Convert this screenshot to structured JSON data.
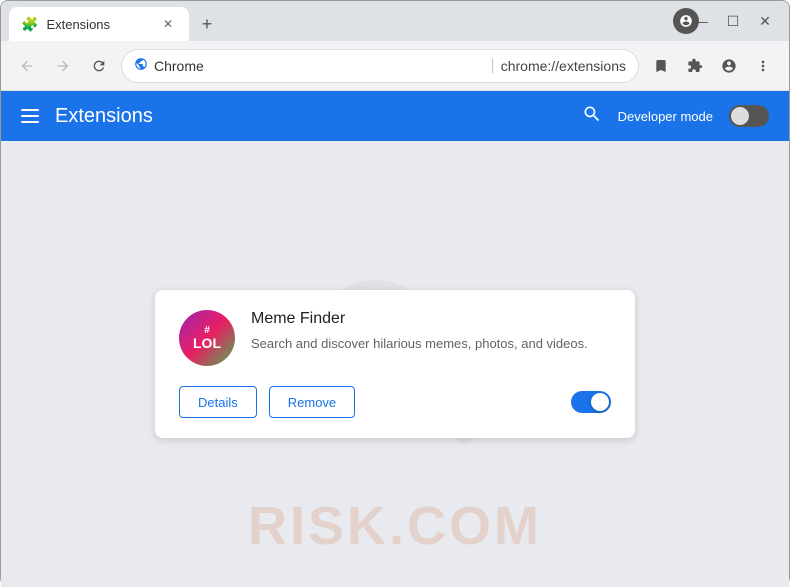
{
  "window": {
    "title": "Extensions",
    "tab_title": "Extensions",
    "tab_icon": "🧩"
  },
  "controls": {
    "minimize": "—",
    "maximize": "☐",
    "close": "✕"
  },
  "address_bar": {
    "site_name": "Chrome",
    "url": "chrome://extensions",
    "back_disabled": true,
    "forward_disabled": true
  },
  "header": {
    "title": "Extensions",
    "search_icon": "search",
    "dev_mode_label": "Developer mode",
    "dev_mode_enabled": false
  },
  "extension": {
    "name": "Meme Finder",
    "description": "Search and discover hilarious memes, photos, and videos.",
    "logo_line1": "#",
    "logo_line2": "LOL",
    "enabled": true,
    "details_label": "Details",
    "remove_label": "Remove"
  },
  "watermark": {
    "text": "RISK.COM"
  }
}
